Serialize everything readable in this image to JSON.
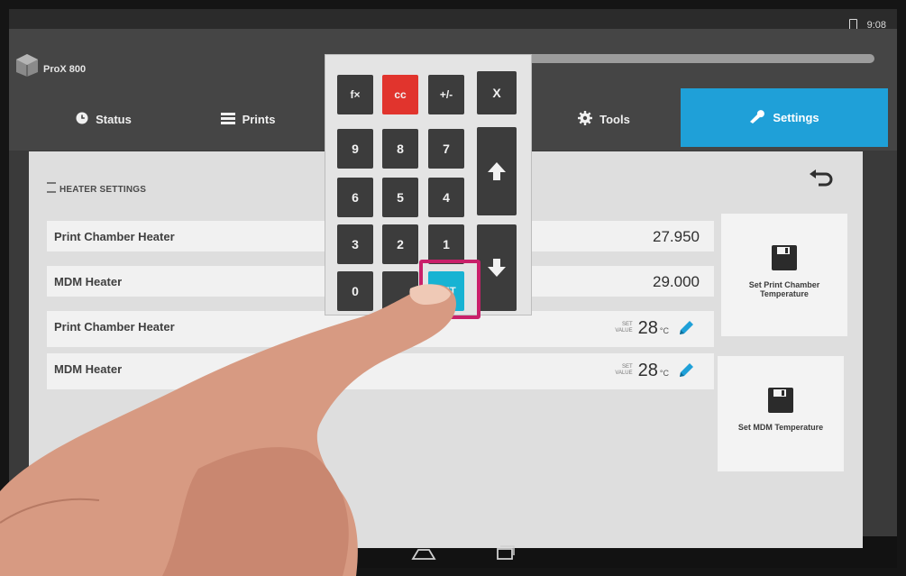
{
  "status_bar": {
    "time": "9:08"
  },
  "app": {
    "printer_name": "ProX 800"
  },
  "tabs": [
    {
      "label": "Status",
      "icon": "clock-icon"
    },
    {
      "label": "Prints",
      "icon": "list-icon"
    },
    {
      "label": "Tools",
      "icon": "gear-icon"
    },
    {
      "label": "Settings",
      "icon": "wrench-icon",
      "active": true
    }
  ],
  "section": {
    "title": "HEATER SETTINGS"
  },
  "rows": [
    {
      "label": "Print Chamber Heater",
      "value": "27.950"
    },
    {
      "label": "MDM Heater",
      "value": "29.000"
    },
    {
      "label": "Print Chamber Heater",
      "set_label_1": "SET",
      "set_label_2": "VALUE",
      "temp": "28",
      "unit": "°C"
    },
    {
      "label": "MDM Heater",
      "set_label_1": "SET",
      "set_label_2": "VALUE",
      "temp": "28",
      "unit": "°C"
    }
  ],
  "actions": [
    {
      "label": "Set Print Chamber Temperature"
    },
    {
      "label": "Set MDM Temperature"
    }
  ],
  "keypad": {
    "fx": "f×",
    "clear": "cc",
    "sign": "+/-",
    "close": "X",
    "digits": [
      "9",
      "8",
      "7",
      "6",
      "5",
      "4",
      "3",
      "2",
      "1",
      "0"
    ],
    "set": "SET",
    "up": "up-arrow-icon",
    "down": "down-arrow-icon"
  },
  "colors": {
    "accent": "#1fa0d8",
    "clear_key": "#e1342d",
    "set_key": "#17b3d3",
    "highlight": "#c9206a"
  }
}
